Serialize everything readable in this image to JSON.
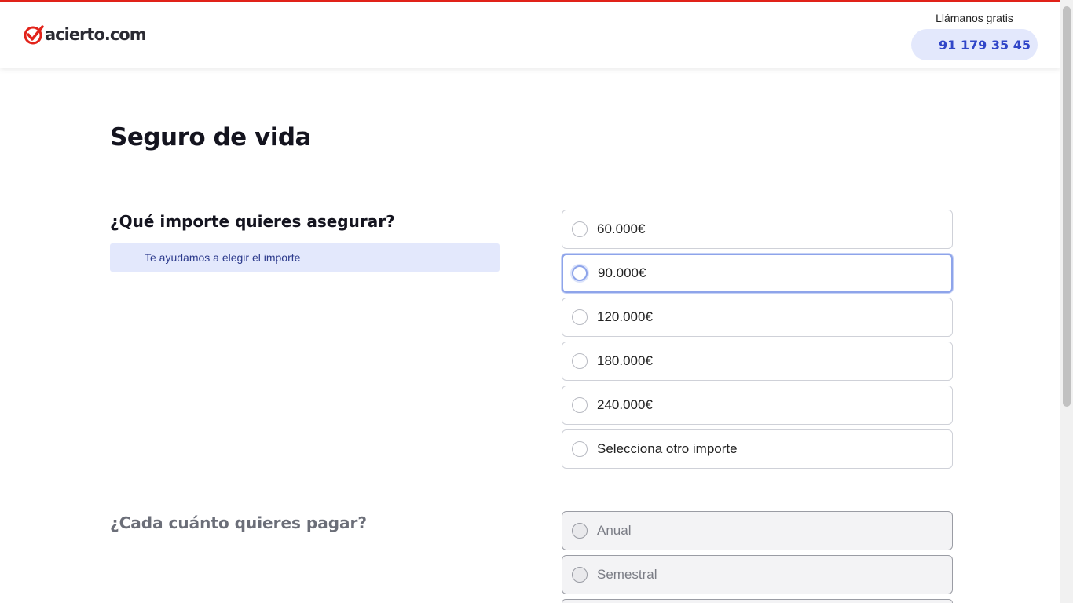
{
  "header": {
    "logo_text": "acierto.com",
    "call_label": "Llámanos gratis",
    "phone": "91 179 35 45",
    "colors": {
      "brand_red": "#e2231a",
      "accent_blue": "#3146c8"
    }
  },
  "page": {
    "title": "Seguro de vida"
  },
  "amount_question": {
    "title": "¿Qué importe quieres asegurar?",
    "help_text": "Te ayudamos a elegir el importe",
    "options": [
      {
        "label": "60.000€"
      },
      {
        "label": "90.000€"
      },
      {
        "label": "120.000€"
      },
      {
        "label": "180.000€"
      },
      {
        "label": "240.000€"
      },
      {
        "label": "Selecciona otro importe"
      }
    ]
  },
  "frequency_question": {
    "title": "¿Cada cuánto quieres pagar?",
    "options": [
      {
        "label": "Anual"
      },
      {
        "label": "Semestral"
      }
    ]
  }
}
